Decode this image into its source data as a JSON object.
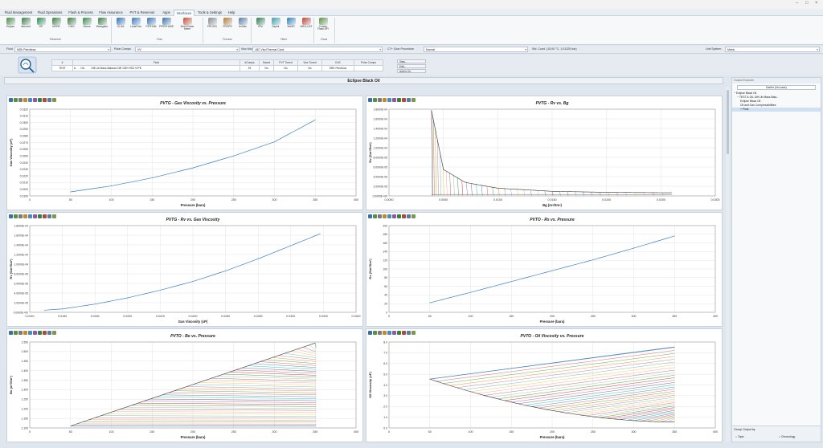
{
  "window": {
    "controls": [
      "–",
      "□",
      "×"
    ]
  },
  "tabs": [
    "Fluid Management",
    "Fluid Operations",
    "Flash & Process",
    "Flow Assurance",
    "PVT & Reservoir",
    "Apps",
    "Interfaces",
    "Tools & Settings",
    "Help"
  ],
  "active_tab": "Interfaces",
  "ribbon": {
    "buttons": [
      {
        "label": "Eclipse",
        "icon": "eclipse-icon",
        "color": "#4a8a3c"
      },
      {
        "label": "Intersect",
        "icon": "intersect-icon",
        "color": "#3d7d40"
      },
      {
        "label": "VIP",
        "icon": "vip-icon",
        "color": "#2f8a4a"
      },
      {
        "label": "MORE",
        "icon": "more-icon",
        "color": "#3a7f3a"
      },
      {
        "label": "CMG",
        "icon": "cmg-icon",
        "color": "#417a3a"
      },
      {
        "label": "Nexus",
        "icon": "nexus-icon",
        "color": "#3a8a45"
      },
      {
        "label": "tNavigator",
        "icon": "tnavigator-icon",
        "color": "#3c7d3c"
      },
      {
        "label": "OLGA",
        "icon": "olga-icon",
        "color": "#2f6fb0"
      },
      {
        "label": "LedaFlow",
        "icon": "ledaflow-icon",
        "color": "#3a78b8"
      },
      {
        "label": "PIPESIM",
        "icon": "pipesim-icon",
        "color": "#3974b4"
      },
      {
        "label": "PIPEPHASE",
        "icon": "pipephase-icon",
        "color": "#3a6fa8"
      },
      {
        "label": "Multi Phase Meter",
        "icon": "meter-icon",
        "color": "#cc4b2a"
      },
      {
        "label": "PROSCI",
        "icon": "prosci-icon",
        "color": "#8a8a8a"
      },
      {
        "label": "PROPR",
        "icon": "propr-icon",
        "color": "#b87a2e"
      },
      {
        "label": "UniSim",
        "icon": "unisim-icon",
        "color": "#5a7aa0"
      },
      {
        "label": "IPM",
        "icon": "ipm-icon",
        "color": "#2e7a4a"
      },
      {
        "label": "Saphir",
        "icon": "saphir-icon",
        "color": "#3aa0a8"
      },
      {
        "label": "WellPi",
        "icon": "wellpi-icon",
        "color": "#2f7fb8"
      },
      {
        "label": "WELLCAT",
        "icon": "wellcat-icon",
        "color": "#c2402a"
      },
      {
        "label": "Coherp Flash API",
        "icon": "flash-api-icon",
        "color": "#5c8f3e"
      }
    ],
    "groups": [
      "Reservoir",
      "Flow",
      "Process",
      "Other",
      "Cloud"
    ]
  },
  "selection": {
    "fluid_label": "Fluid",
    "fluid_value": "MSK Petrolleau",
    "polar_label": "Polar Comps",
    "polar_value": "HV",
    "visc_label": "Visc Model",
    "visc_value": "LBC Visc/Thermal Cond",
    "c7_label": "C7+ Char Procedure",
    "c7_value": "Normal",
    "std_cond": "Std. Cond. (15.00 °C, 1.01325 bar)",
    "unit_label": "Unit System",
    "unit_value": "Metric"
  },
  "fluid_grid": {
    "headers": [
      "#",
      "Fluid",
      "#Comps",
      "Saved",
      "PVT Tuned",
      "Visc Tuned",
      "EoS",
      "Polar Comps"
    ],
    "row": [
      "TEST",
      "&",
      "OIL",
      "Diff Lib Mass Balance   Diff 138+VISC+CPE",
      "29",
      "No",
      "No",
      "No",
      "SRK Peneloux",
      ""
    ],
    "buttons": [
      "View...",
      "Edit...",
      "Add to Gr..."
    ]
  },
  "main_title": "Eclipse Black Oil",
  "explorer": {
    "title": "Output Explorer",
    "button": "Earlier (No case)",
    "tree": [
      "− Eclipse Black Oil",
      "− TEST   &   OIL   Diff Lib Mass Bala...",
      "Eclipse Black Oil",
      "Oil and Gas Compressibilities",
      "+ Plots"
    ],
    "group_by": "Group Output by",
    "options": [
      "Topic",
      "Chronology"
    ]
  },
  "chart_data": [
    {
      "type": "line",
      "title": "PVTG - Gas Viscosity vs. Pressure",
      "xlabel": "Pressure (bara)",
      "ylabel": "Gas Viscosity (cP)",
      "xlim": [
        0,
        400
      ],
      "ylim": [
        0.019,
        0.032
      ],
      "xticks": [
        "0",
        "50",
        "100",
        "150",
        "200",
        "250",
        "300",
        "350",
        "400"
      ],
      "yticks": [
        "0.0190",
        "0.0200",
        "0.0210",
        "0.0220",
        "0.0230",
        "0.0240",
        "0.0250",
        "0.0260",
        "0.0270",
        "0.0280",
        "0.0290",
        "0.0300",
        "0.0310",
        "0.0320"
      ],
      "series": [
        {
          "x": [
            50,
            100,
            150,
            200,
            250,
            300,
            350
          ],
          "y": [
            0.0196,
            0.0205,
            0.0217,
            0.0232,
            0.025,
            0.0271,
            0.0304
          ]
        }
      ]
    },
    {
      "type": "line",
      "title": "PVTG - Rv vs. Bg",
      "xlabel": "Bg (m³/Sm³)",
      "ylabel": "Rv (Sm³/Sm³)",
      "xlim": [
        0,
        0.03
      ],
      "ylim": [
        0,
        0.00018
      ],
      "xticks": [
        "0.0000",
        "0.0050",
        "0.0100",
        "0.0150",
        "0.0200",
        "0.0250",
        "0.0300"
      ],
      "yticks": [
        "0.0000E+00",
        "2.0000E-05",
        "4.0000E-05",
        "6.0000E-05",
        "8.0000E-05",
        "1.0000E-04",
        "1.2000E-04",
        "1.4000E-04",
        "1.6000E-04",
        "1.8000E-04"
      ],
      "series": [
        {
          "x": [
            0.0039,
            0.005,
            0.007,
            0.01,
            0.015,
            0.02,
            0.026
          ],
          "y": [
            0.000178,
            5.5e-05,
            2.8e-05,
            1.6e-05,
            9.5e-06,
            7.5e-06,
            6.5e-06
          ]
        }
      ]
    },
    {
      "type": "line",
      "title": "PVTG - Rv vs. Gas Viscosity",
      "xlabel": "Gas Viscosity (cP)",
      "ylabel": "Rv (Sm³/Sm³)",
      "xlim": [
        0.014,
        0.034
      ],
      "ylim": [
        0,
        0.00018
      ],
      "xticks": [
        "0.0140",
        "0.0160",
        "0.0180",
        "0.0200",
        "0.0220",
        "0.0240",
        "0.0260",
        "0.0280",
        "0.0300",
        "0.0320",
        "0.0340"
      ],
      "yticks": [
        "0.0000E+00",
        "2.0000E-05",
        "4.0000E-05",
        "6.0000E-05",
        "8.0000E-05",
        "1.0000E-04",
        "1.2000E-04",
        "1.4000E-04",
        "1.6000E-04",
        "1.8000E-04"
      ],
      "series": [
        {
          "x": [
            0.0149,
            0.016,
            0.018,
            0.02,
            0.022,
            0.024,
            0.026,
            0.028,
            0.0318
          ],
          "y": [
            4.5e-06,
            7e-06,
            1.7e-05,
            3e-05,
            4.6e-05,
            6.4e-05,
            8.6e-05,
            0.000111,
            0.000163
          ]
        }
      ]
    },
    {
      "type": "line",
      "title": "PVTO - Rs vs. Pressure",
      "xlabel": "Pressure (bara)",
      "ylabel": "Rs (Sm³/Sm³)",
      "xlim": [
        0,
        400
      ],
      "ylim": [
        0,
        200
      ],
      "xticks": [
        "0",
        "50",
        "100",
        "150",
        "200",
        "250",
        "300",
        "350",
        "400"
      ],
      "yticks": [
        "0",
        "20",
        "40",
        "60",
        "80",
        "100",
        "120",
        "140",
        "160",
        "180",
        "200"
      ],
      "series": [
        {
          "x": [
            50,
            100,
            150,
            200,
            250,
            300,
            350
          ],
          "y": [
            22,
            46,
            71,
            96,
            121,
            148,
            176
          ]
        }
      ]
    },
    {
      "type": "line",
      "title": "PVTO - Bo vs. Pressure",
      "xlabel": "Pressure (bara)",
      "ylabel": "Bo (m³/Sm³)",
      "xlim": [
        0,
        400
      ],
      "ylim": [
        1.1,
        1.55
      ],
      "xticks": [
        "0",
        "50",
        "100",
        "150",
        "200",
        "250",
        "300",
        "350",
        "400"
      ],
      "yticks": [
        "1.100",
        "1.150",
        "1.200",
        "1.250",
        "1.300",
        "1.350",
        "1.400",
        "1.450",
        "1.500",
        "1.550"
      ],
      "series": [
        {
          "x": [
            50,
            350
          ],
          "y": [
            1.11,
            1.545
          ]
        }
      ]
    },
    {
      "type": "line",
      "title": "PVTO - Oil Viscosity vs. Pressure",
      "xlabel": "Pressure (bara)",
      "ylabel": "Oil Viscosity (cP)",
      "xlim": [
        0,
        400
      ],
      "ylim": [
        0,
        8
      ],
      "xticks": [
        "0",
        "50",
        "100",
        "150",
        "200",
        "250",
        "300",
        "350",
        "400"
      ],
      "yticks": [
        "0.0",
        "1.0",
        "2.0",
        "3.0",
        "4.0",
        "5.0",
        "6.0",
        "7.0",
        "8.0"
      ],
      "series": [
        {
          "x": [
            50,
            350
          ],
          "y": [
            4.55,
            7.55
          ]
        }
      ]
    }
  ]
}
